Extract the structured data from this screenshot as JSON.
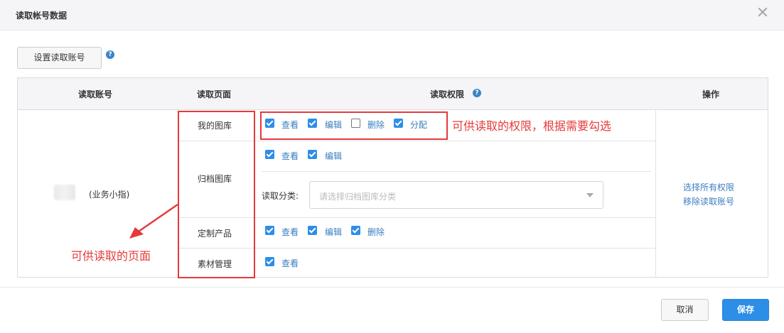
{
  "dialog": {
    "title": "读取帐号数据",
    "close_glyph": "✕"
  },
  "toolbar": {
    "set_account_label": "设置读取账号"
  },
  "table": {
    "headers": {
      "account": "读取账号",
      "page": "读取页面",
      "permission": "读取权限",
      "operation": "操作"
    },
    "account_name": "(业务小指)",
    "rows": [
      {
        "page": "我的图库",
        "perms": [
          {
            "label": "查看",
            "checked": true
          },
          {
            "label": "编辑",
            "checked": true
          },
          {
            "label": "删除",
            "checked": false
          },
          {
            "label": "分配",
            "checked": true
          }
        ]
      },
      {
        "page": "归档图库",
        "perms": [
          {
            "label": "查看",
            "checked": true
          },
          {
            "label": "编辑",
            "checked": true
          }
        ],
        "category_label": "读取分类:",
        "category_placeholder": "请选择归档图库分类"
      },
      {
        "page": "定制产品",
        "perms": [
          {
            "label": "查看",
            "checked": true
          },
          {
            "label": "编辑",
            "checked": true
          },
          {
            "label": "删除",
            "checked": true
          }
        ]
      },
      {
        "page": "素材管理",
        "perms": [
          {
            "label": "查看",
            "checked": true
          }
        ]
      }
    ],
    "operations": {
      "select_all": "选择所有权限",
      "remove_account": "移除读取账号"
    }
  },
  "annotations": {
    "permission_note": "可供读取的权限，根据需要勾选",
    "page_note": "可供读取的页面",
    "color": "#e53a3a"
  },
  "footer": {
    "cancel_label": "取消",
    "save_label": "保存"
  },
  "colors": {
    "accent": "#2d8ee8",
    "link": "#3a7ebf"
  }
}
